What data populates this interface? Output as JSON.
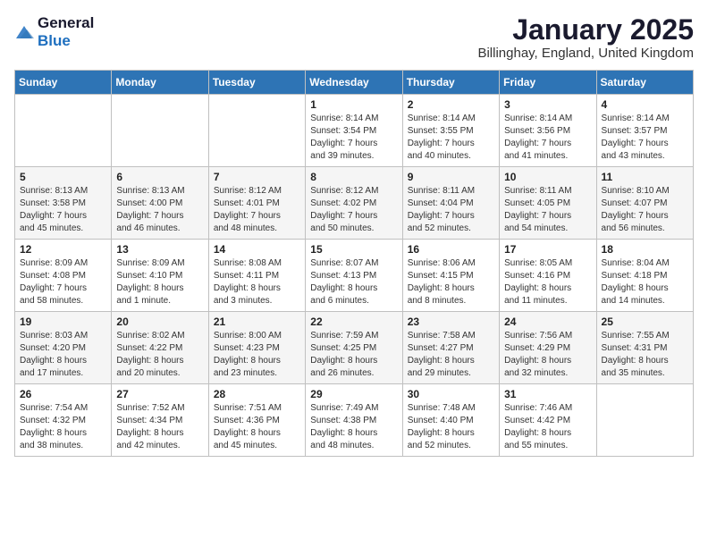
{
  "logo": {
    "general": "General",
    "blue": "Blue"
  },
  "title": {
    "month": "January 2025",
    "location": "Billinghay, England, United Kingdom"
  },
  "weekdays": [
    "Sunday",
    "Monday",
    "Tuesday",
    "Wednesday",
    "Thursday",
    "Friday",
    "Saturday"
  ],
  "weeks": [
    [
      {
        "day": "",
        "info": ""
      },
      {
        "day": "",
        "info": ""
      },
      {
        "day": "",
        "info": ""
      },
      {
        "day": "1",
        "info": "Sunrise: 8:14 AM\nSunset: 3:54 PM\nDaylight: 7 hours\nand 39 minutes."
      },
      {
        "day": "2",
        "info": "Sunrise: 8:14 AM\nSunset: 3:55 PM\nDaylight: 7 hours\nand 40 minutes."
      },
      {
        "day": "3",
        "info": "Sunrise: 8:14 AM\nSunset: 3:56 PM\nDaylight: 7 hours\nand 41 minutes."
      },
      {
        "day": "4",
        "info": "Sunrise: 8:14 AM\nSunset: 3:57 PM\nDaylight: 7 hours\nand 43 minutes."
      }
    ],
    [
      {
        "day": "5",
        "info": "Sunrise: 8:13 AM\nSunset: 3:58 PM\nDaylight: 7 hours\nand 45 minutes."
      },
      {
        "day": "6",
        "info": "Sunrise: 8:13 AM\nSunset: 4:00 PM\nDaylight: 7 hours\nand 46 minutes."
      },
      {
        "day": "7",
        "info": "Sunrise: 8:12 AM\nSunset: 4:01 PM\nDaylight: 7 hours\nand 48 minutes."
      },
      {
        "day": "8",
        "info": "Sunrise: 8:12 AM\nSunset: 4:02 PM\nDaylight: 7 hours\nand 50 minutes."
      },
      {
        "day": "9",
        "info": "Sunrise: 8:11 AM\nSunset: 4:04 PM\nDaylight: 7 hours\nand 52 minutes."
      },
      {
        "day": "10",
        "info": "Sunrise: 8:11 AM\nSunset: 4:05 PM\nDaylight: 7 hours\nand 54 minutes."
      },
      {
        "day": "11",
        "info": "Sunrise: 8:10 AM\nSunset: 4:07 PM\nDaylight: 7 hours\nand 56 minutes."
      }
    ],
    [
      {
        "day": "12",
        "info": "Sunrise: 8:09 AM\nSunset: 4:08 PM\nDaylight: 7 hours\nand 58 minutes."
      },
      {
        "day": "13",
        "info": "Sunrise: 8:09 AM\nSunset: 4:10 PM\nDaylight: 8 hours\nand 1 minute."
      },
      {
        "day": "14",
        "info": "Sunrise: 8:08 AM\nSunset: 4:11 PM\nDaylight: 8 hours\nand 3 minutes."
      },
      {
        "day": "15",
        "info": "Sunrise: 8:07 AM\nSunset: 4:13 PM\nDaylight: 8 hours\nand 6 minutes."
      },
      {
        "day": "16",
        "info": "Sunrise: 8:06 AM\nSunset: 4:15 PM\nDaylight: 8 hours\nand 8 minutes."
      },
      {
        "day": "17",
        "info": "Sunrise: 8:05 AM\nSunset: 4:16 PM\nDaylight: 8 hours\nand 11 minutes."
      },
      {
        "day": "18",
        "info": "Sunrise: 8:04 AM\nSunset: 4:18 PM\nDaylight: 8 hours\nand 14 minutes."
      }
    ],
    [
      {
        "day": "19",
        "info": "Sunrise: 8:03 AM\nSunset: 4:20 PM\nDaylight: 8 hours\nand 17 minutes."
      },
      {
        "day": "20",
        "info": "Sunrise: 8:02 AM\nSunset: 4:22 PM\nDaylight: 8 hours\nand 20 minutes."
      },
      {
        "day": "21",
        "info": "Sunrise: 8:00 AM\nSunset: 4:23 PM\nDaylight: 8 hours\nand 23 minutes."
      },
      {
        "day": "22",
        "info": "Sunrise: 7:59 AM\nSunset: 4:25 PM\nDaylight: 8 hours\nand 26 minutes."
      },
      {
        "day": "23",
        "info": "Sunrise: 7:58 AM\nSunset: 4:27 PM\nDaylight: 8 hours\nand 29 minutes."
      },
      {
        "day": "24",
        "info": "Sunrise: 7:56 AM\nSunset: 4:29 PM\nDaylight: 8 hours\nand 32 minutes."
      },
      {
        "day": "25",
        "info": "Sunrise: 7:55 AM\nSunset: 4:31 PM\nDaylight: 8 hours\nand 35 minutes."
      }
    ],
    [
      {
        "day": "26",
        "info": "Sunrise: 7:54 AM\nSunset: 4:32 PM\nDaylight: 8 hours\nand 38 minutes."
      },
      {
        "day": "27",
        "info": "Sunrise: 7:52 AM\nSunset: 4:34 PM\nDaylight: 8 hours\nand 42 minutes."
      },
      {
        "day": "28",
        "info": "Sunrise: 7:51 AM\nSunset: 4:36 PM\nDaylight: 8 hours\nand 45 minutes."
      },
      {
        "day": "29",
        "info": "Sunrise: 7:49 AM\nSunset: 4:38 PM\nDaylight: 8 hours\nand 48 minutes."
      },
      {
        "day": "30",
        "info": "Sunrise: 7:48 AM\nSunset: 4:40 PM\nDaylight: 8 hours\nand 52 minutes."
      },
      {
        "day": "31",
        "info": "Sunrise: 7:46 AM\nSunset: 4:42 PM\nDaylight: 8 hours\nand 55 minutes."
      },
      {
        "day": "",
        "info": ""
      }
    ]
  ]
}
